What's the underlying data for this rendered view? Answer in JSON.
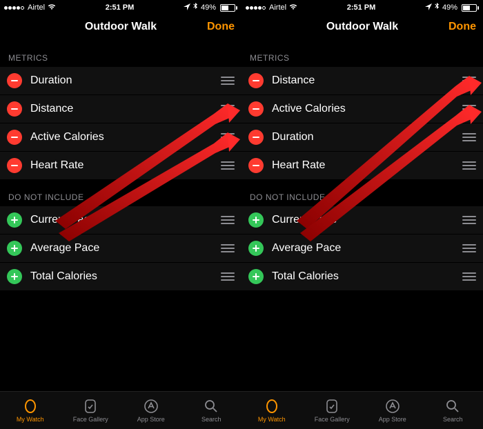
{
  "panels": [
    {
      "status": {
        "carrier": "Airtel",
        "time": "2:51 PM",
        "battery_pct": "49%"
      },
      "nav": {
        "title": "Outdoor Walk",
        "done": "Done"
      },
      "sections": {
        "metrics_header": "METRICS",
        "metrics": [
          {
            "label": "Duration"
          },
          {
            "label": "Distance"
          },
          {
            "label": "Active Calories"
          },
          {
            "label": "Heart Rate"
          }
        ],
        "exclude_header": "DO NOT INCLUDE",
        "exclude": [
          {
            "label": "Current Pace"
          },
          {
            "label": "Average Pace"
          },
          {
            "label": "Total Calories"
          }
        ]
      },
      "tabs": [
        {
          "label": "My Watch",
          "active": true
        },
        {
          "label": "Face Gallery",
          "active": false
        },
        {
          "label": "App Store",
          "active": false
        },
        {
          "label": "Search",
          "active": false
        }
      ]
    },
    {
      "status": {
        "carrier": "Airtel",
        "time": "2:51 PM",
        "battery_pct": "49%"
      },
      "nav": {
        "title": "Outdoor Walk",
        "done": "Done"
      },
      "sections": {
        "metrics_header": "METRICS",
        "metrics": [
          {
            "label": "Distance"
          },
          {
            "label": "Active Calories"
          },
          {
            "label": "Duration"
          },
          {
            "label": "Heart Rate"
          }
        ],
        "exclude_header": "DO NOT INCLUDE",
        "exclude": [
          {
            "label": "Current Pace"
          },
          {
            "label": "Average Pace"
          },
          {
            "label": "Total Calories"
          }
        ]
      },
      "tabs": [
        {
          "label": "My Watch",
          "active": true
        },
        {
          "label": "Face Gallery",
          "active": false
        },
        {
          "label": "App Store",
          "active": false
        },
        {
          "label": "Search",
          "active": false
        }
      ]
    }
  ]
}
